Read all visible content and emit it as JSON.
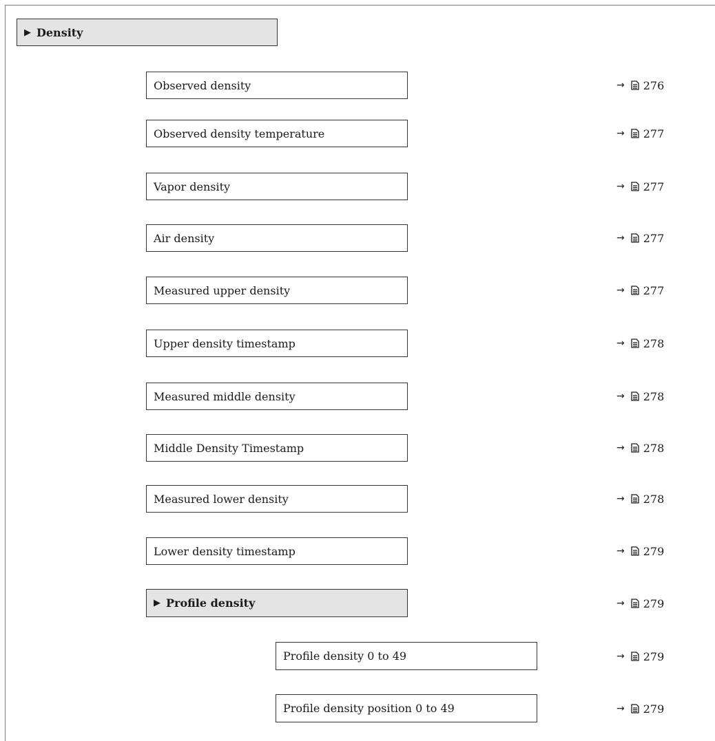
{
  "header": {
    "label": "Density"
  },
  "items": [
    {
      "label": "Observed density",
      "page": "276"
    },
    {
      "label": "Observed density temperature",
      "page": "277"
    },
    {
      "label": "Vapor density",
      "page": "277"
    },
    {
      "label": "Air density",
      "page": "277"
    },
    {
      "label": "Measured upper density",
      "page": "277"
    },
    {
      "label": "Upper density timestamp",
      "page": "278"
    },
    {
      "label": "Measured middle density",
      "page": "278"
    },
    {
      "label": "Middle Density Timestamp",
      "page": "278"
    },
    {
      "label": "Measured lower density",
      "page": "278"
    },
    {
      "label": "Lower density timestamp",
      "page": "279"
    }
  ],
  "submenu": {
    "label": "Profile density",
    "page": "279"
  },
  "subitems": [
    {
      "label": "Profile density 0 to 49",
      "page": "279"
    },
    {
      "label": "Profile density position 0 to 49",
      "page": "279"
    }
  ],
  "colors": {
    "submenu_fill": "#e4e4e4",
    "border": "#333333"
  },
  "icons": {
    "expand": "triangle-right-icon",
    "reference": "page-reference-icon"
  }
}
